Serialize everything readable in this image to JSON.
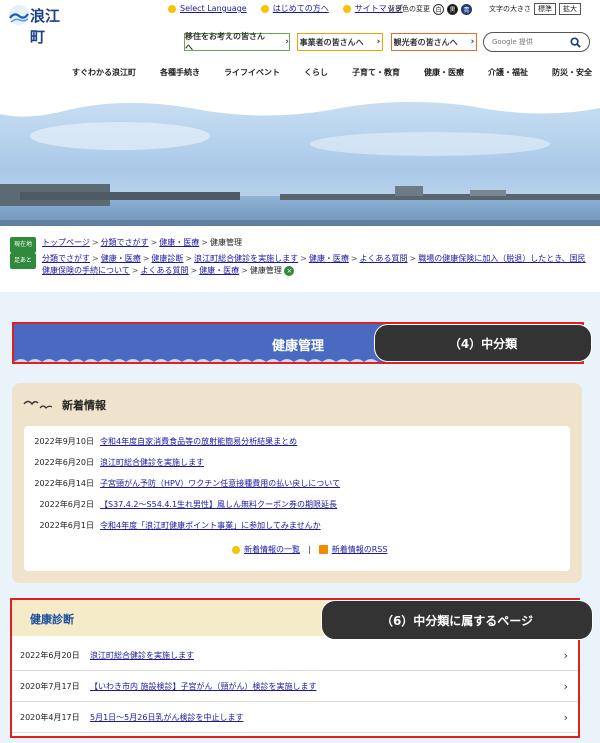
{
  "header": {
    "logo_text": "浪江町",
    "top_links": [
      "Select Language",
      "はじめての方へ",
      "サイトマップ"
    ],
    "bg_color_label": "背景色の変更",
    "bg_buttons": [
      "白",
      "黒",
      "青"
    ],
    "text_size_label": "文字の大きさ",
    "text_size_buttons": [
      "標準",
      "拡大"
    ],
    "audience_buttons": [
      "移住をお考えの皆さんへ",
      "事業者の皆さんへ",
      "観光者の皆さんへ"
    ],
    "search_placeholder": "Google 提供"
  },
  "main_nav": [
    "すぐわかる浪江町",
    "各種手続き",
    "ライフイベント",
    "くらし",
    "子育て・教育",
    "健康・医療",
    "介護・福祉",
    "防災・安全"
  ],
  "breadcrumb": {
    "current_label": "現在地",
    "current": [
      "トップページ",
      "分類でさがす",
      "健康・医療",
      "健康管理"
    ],
    "history_label": "足あと",
    "history": [
      "分類でさがす",
      "健康・医療",
      "健康診断",
      "浪江町総合健診を実施します",
      "健康・医療",
      "よくある質問",
      "職場の健康保険に加入（脱退）したとき、国民健康保険の手続について",
      "よくある質問",
      "健康・医療",
      "健康管理"
    ]
  },
  "section_title": "健康管理",
  "callout_1": "（4）中分類",
  "callout_2": "（6）中分類に属するページ",
  "news": {
    "heading": "新着情報",
    "items": [
      {
        "date": "2022年9月10日",
        "title": "令和4年度自家消費食品等の放射能簡易分析結果まとめ"
      },
      {
        "date": "2022年6月20日",
        "title": "浪江町総合健診を実施します"
      },
      {
        "date": "2022年6月14日",
        "title": "子宮頸がん予防（HPV）ワクチン任意接種費用の払い戻しについて"
      },
      {
        "date": "2022年6月2日",
        "title": "【S37.4.2～S54.4.1生れ男性】風しん無料クーポン券の期限延長"
      },
      {
        "date": "2022年6月1日",
        "title": "令和4年度「浪江町健康ポイント事業」に参加してみませんか"
      }
    ],
    "list_link": "新着情報の一覧",
    "rss_link": "新着情報のRSS"
  },
  "pages": {
    "heading": "健康診断",
    "items": [
      {
        "date": "2022年6月20日",
        "title": "浪江町総合健診を実施します"
      },
      {
        "date": "2020年7月17日",
        "title": "【いわき市内 施設検診】子宮がん（頸がん）検診を実施します"
      },
      {
        "date": "2020年4月17日",
        "title": "5月1日～5月26日乳がん検診を中止します"
      }
    ]
  }
}
